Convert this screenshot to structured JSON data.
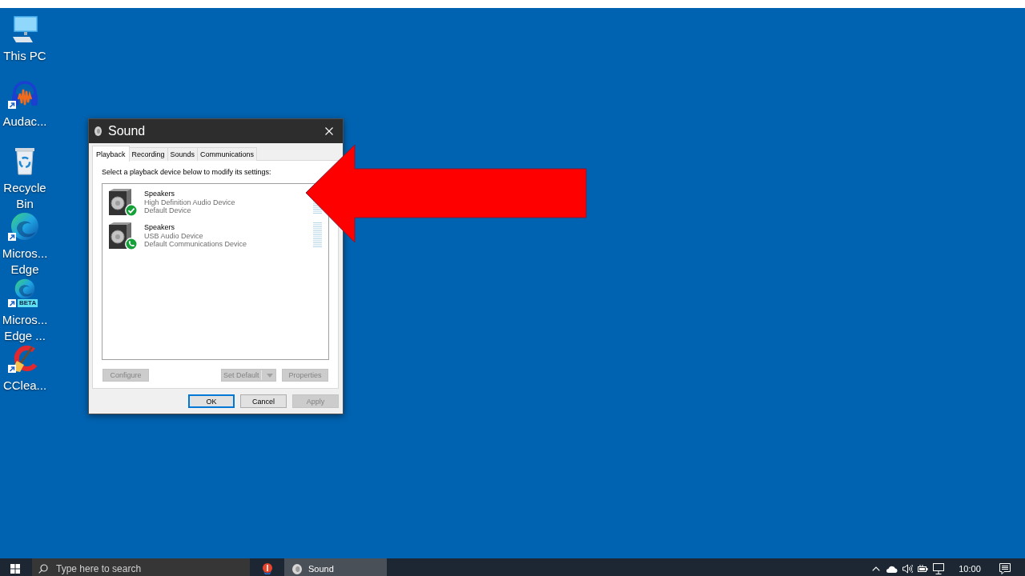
{
  "desktop": {
    "icons": [
      {
        "label": "This PC",
        "kind": "computer",
        "shortcut": false
      },
      {
        "label": "Audac...",
        "kind": "audio-editor",
        "shortcut": true
      },
      {
        "label": "Recycle Bin",
        "kind": "recycle-bin",
        "shortcut": false
      },
      {
        "label": "Micros... Edge",
        "kind": "browser",
        "shortcut": true
      },
      {
        "label": "Micros... Edge ...",
        "kind": "browser",
        "shortcut": true,
        "badge": "BETA"
      },
      {
        "label": "CClea...",
        "kind": "cleaner",
        "shortcut": true
      }
    ]
  },
  "dialog": {
    "title": "Sound",
    "tabs": [
      {
        "label": "Playback",
        "selected": true
      },
      {
        "label": "Recording",
        "selected": false
      },
      {
        "label": "Sounds",
        "selected": false
      },
      {
        "label": "Communications",
        "selected": false
      }
    ],
    "instruction": "Select a playback device below to modify its settings:",
    "devices": [
      {
        "name": "Speakers",
        "description": "High Definition Audio Device",
        "status": "Default Device",
        "kind": "default",
        "selected": false
      },
      {
        "name": "Speakers",
        "description": "USB Audio Device",
        "status": "Default Communications Device",
        "kind": "communications",
        "selected": false
      }
    ],
    "list_buttons": [
      {
        "label": "Configure",
        "kind": "plain",
        "disabled": true
      },
      {
        "label": "Set Default",
        "kind": "split",
        "disabled": true
      },
      {
        "label": "Properties",
        "kind": "plain",
        "disabled": true
      }
    ],
    "buttons": [
      {
        "label": "OK",
        "focused": true,
        "disabled": false
      },
      {
        "label": "Cancel",
        "focused": false,
        "disabled": false
      },
      {
        "label": "Apply",
        "focused": false,
        "disabled": true
      }
    ]
  },
  "taskbar": {
    "search": {
      "placeholder": "Type here to search"
    },
    "tasks": [
      {
        "kind": "pinned",
        "selected": false
      },
      {
        "kind": "window",
        "label": "Sound",
        "selected": true
      }
    ],
    "tray": {
      "time": "10:00"
    }
  }
}
